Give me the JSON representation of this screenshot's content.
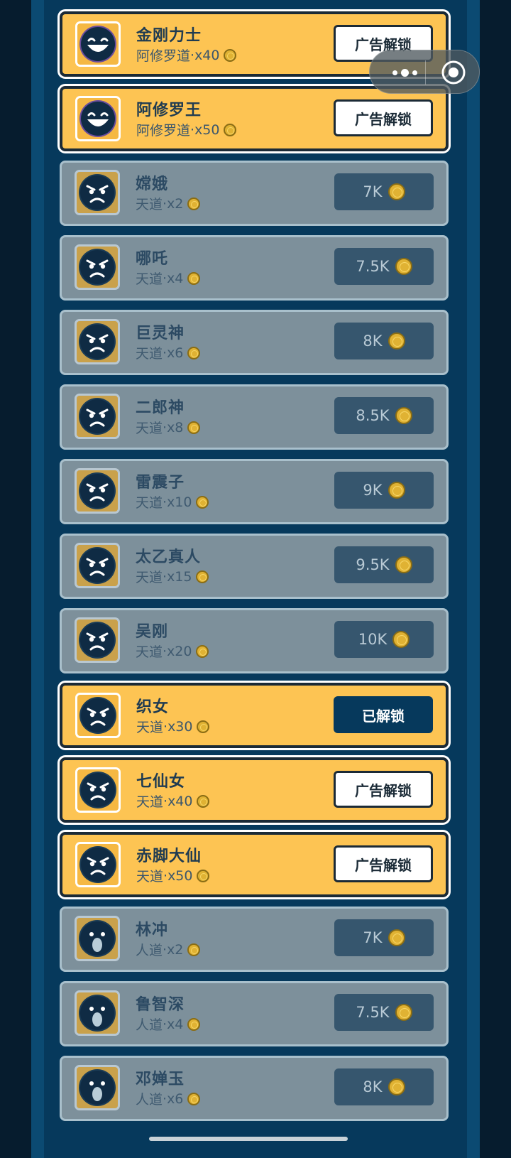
{
  "colors": {
    "locked_bg": "#7d909b",
    "unlocked_bg": "#fdc453",
    "price_btn": "#36566e",
    "unlocked_btn": "#06395c"
  },
  "items": [
    {
      "name": "金刚力士",
      "realm": "阿修罗道",
      "mult": "x40",
      "state": "ad",
      "button": "广告解锁",
      "face": "laughing-face-icon"
    },
    {
      "name": "阿修罗王",
      "realm": "阿修罗道",
      "mult": "x50",
      "state": "ad",
      "button": "广告解锁",
      "face": "laughing-face-icon"
    },
    {
      "name": "嫦娥",
      "realm": "天道",
      "mult": "x2",
      "state": "locked",
      "button": "7K",
      "face": "angry-face-icon"
    },
    {
      "name": "哪吒",
      "realm": "天道",
      "mult": "x4",
      "state": "locked",
      "button": "7.5K",
      "face": "angry-face-icon"
    },
    {
      "name": "巨灵神",
      "realm": "天道",
      "mult": "x6",
      "state": "locked",
      "button": "8K",
      "face": "angry-face-icon"
    },
    {
      "name": "二郎神",
      "realm": "天道",
      "mult": "x8",
      "state": "locked",
      "button": "8.5K",
      "face": "angry-face-icon"
    },
    {
      "name": "雷震子",
      "realm": "天道",
      "mult": "x10",
      "state": "locked",
      "button": "9K",
      "face": "angry-face-icon"
    },
    {
      "name": "太乙真人",
      "realm": "天道",
      "mult": "x15",
      "state": "locked",
      "button": "9.5K",
      "face": "angry-face-icon"
    },
    {
      "name": "吴刚",
      "realm": "天道",
      "mult": "x20",
      "state": "locked",
      "button": "10K",
      "face": "angry-face-icon"
    },
    {
      "name": "织女",
      "realm": "天道",
      "mult": "x30",
      "state": "unlocked",
      "button": "已解锁",
      "face": "angry-face-icon"
    },
    {
      "name": "七仙女",
      "realm": "天道",
      "mult": "x40",
      "state": "ad",
      "button": "广告解锁",
      "face": "angry-face-icon"
    },
    {
      "name": "赤脚大仙",
      "realm": "天道",
      "mult": "x50",
      "state": "ad",
      "button": "广告解锁",
      "face": "angry-face-icon"
    },
    {
      "name": "林冲",
      "realm": "人道",
      "mult": "x2",
      "state": "locked",
      "button": "7K",
      "face": "shocked-face-icon"
    },
    {
      "name": "鲁智深",
      "realm": "人道",
      "mult": "x4",
      "state": "locked",
      "button": "7.5K",
      "face": "shocked-face-icon"
    },
    {
      "name": "邓婵玉",
      "realm": "人道",
      "mult": "x6",
      "state": "locked",
      "button": "8K",
      "face": "shocked-face-icon"
    }
  ],
  "separator": " · ",
  "capsule": {
    "more_icon": "more-dots-icon",
    "close_icon": "target-close-icon"
  }
}
